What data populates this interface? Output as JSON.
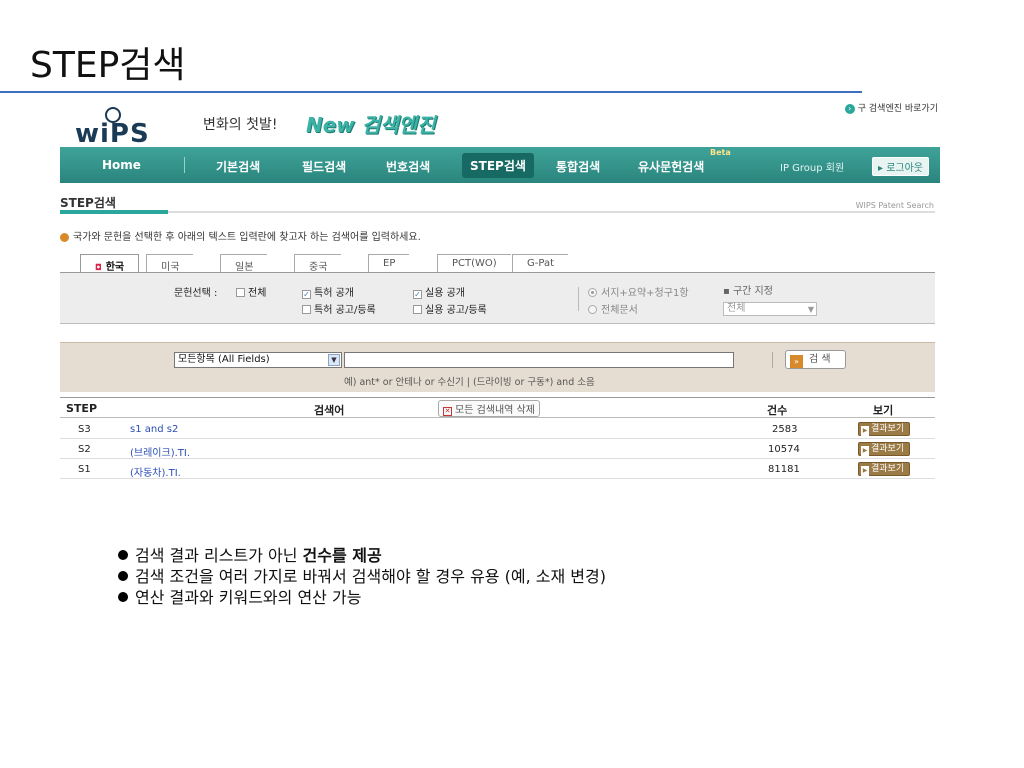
{
  "slide": {
    "title": "STEP검색",
    "bullets": [
      {
        "text": "검색 결과 리스트가 아닌 ",
        "bold": "건수를 제공"
      },
      {
        "text": "검색 조건을 여러 가지로 바꿔서 검색해야 할 경우 유용 (예, 소재 변경)",
        "bold": ""
      },
      {
        "text": "연산 결과와 키워드와의 연산 가능",
        "bold": ""
      }
    ]
  },
  "header": {
    "logo_text": "wiPS",
    "tagline": "변화의 첫발!",
    "brand": "New 검색엔진",
    "old_engine_link": "구 검색엔진 바로가기"
  },
  "nav": {
    "items": [
      "Home",
      "기본검색",
      "필드검색",
      "번호검색",
      "STEP검색",
      "통합검색",
      "유사문헌검색"
    ],
    "active": "STEP검색",
    "beta": "Beta",
    "ip_group": "IP Group 회원",
    "logout": "로그아웃"
  },
  "section": {
    "title": "STEP검색",
    "right_label": "WIPS Patent Search",
    "instruction": "국가와 문헌을 선택한 후 아래의 텍스트 입력란에 찾고자 하는 검색어를 입력하세요."
  },
  "country_tabs": [
    "한국",
    "미국",
    "일본",
    "중국",
    "EP",
    "PCT(WO)",
    "G-Pat"
  ],
  "doc_options": {
    "label": "문헌선택 :",
    "all": "전체",
    "patent_pub": "특허 공개",
    "utility_pub": "실용 공개",
    "patent_reg": "특허 공고/등록",
    "utility_reg": "실용 공고/등록",
    "scope_1": "서지+요약+청구1항",
    "scope_2": "전체문서",
    "range_label": "구간 지정",
    "range_value": "전체"
  },
  "search": {
    "field": "모든항목 (All Fields)",
    "query": "",
    "button": "검 색",
    "hint": "예) ant* or 안테나 or 수신기 | (드라이빙 or 구동*) and 소음"
  },
  "table": {
    "headers": {
      "step": "STEP",
      "query": "검색어",
      "count": "건수",
      "view": "보기"
    },
    "delete_all": "모든 검색내역 삭제",
    "view_label": "결과보기",
    "rows": [
      {
        "step": "S3",
        "query": "s1 and s2",
        "count": "2583"
      },
      {
        "step": "S2",
        "query": "(브레이크).TI.",
        "count": "10574"
      },
      {
        "step": "S1",
        "query": "(자동차).TI.",
        "count": "81181"
      }
    ]
  }
}
